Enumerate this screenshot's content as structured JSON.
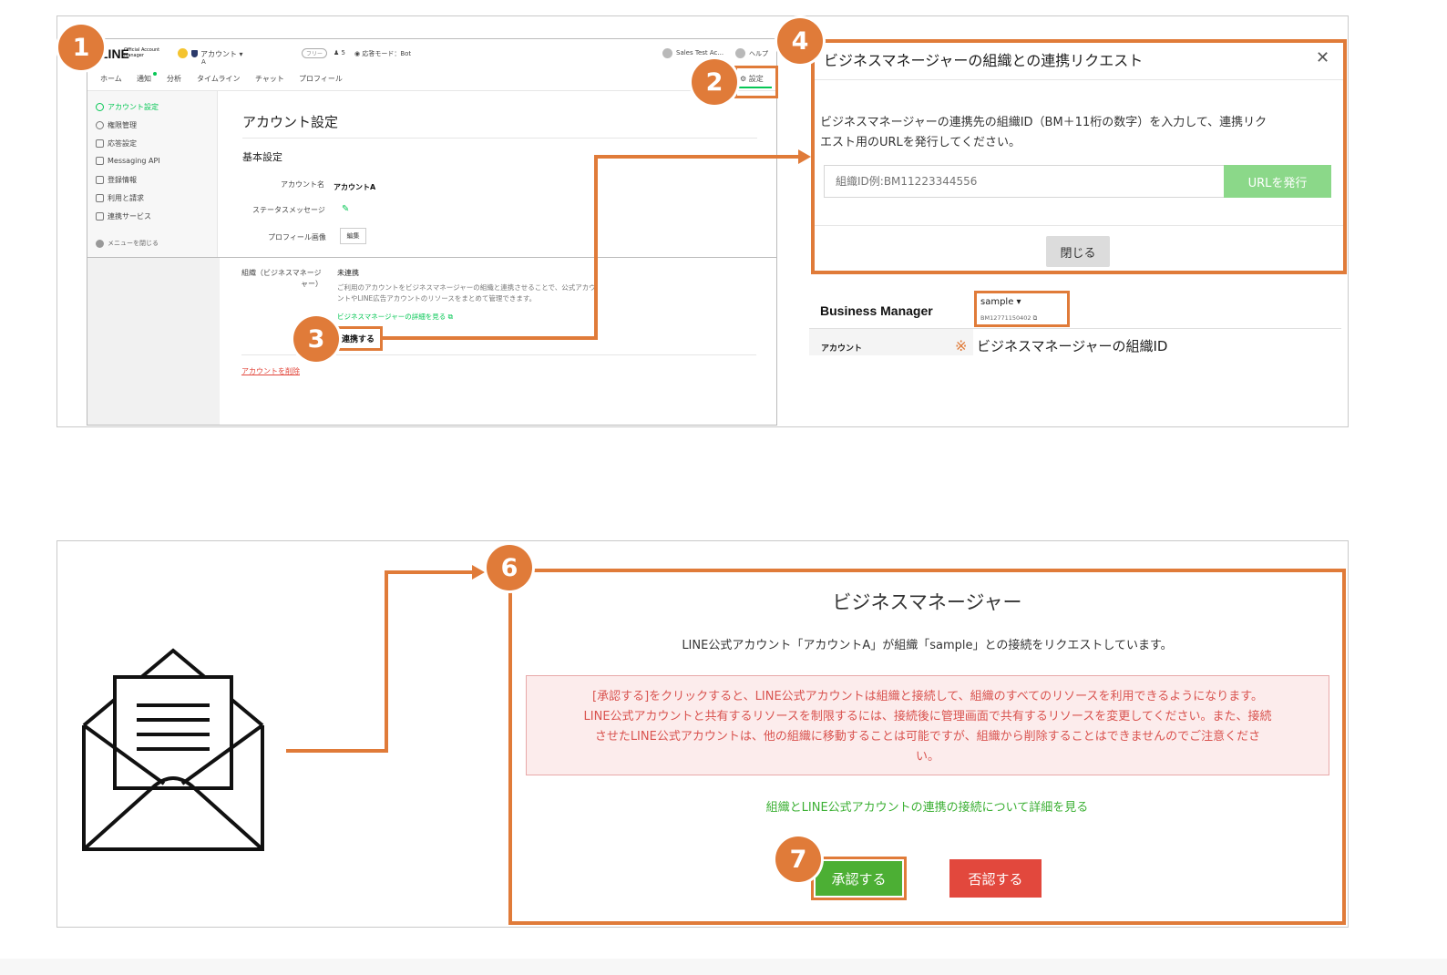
{
  "screen1": {
    "logo": "LINE",
    "logo_sub": "Official Account Manager",
    "account_selector": "アカウント",
    "account_selector_sub": "A",
    "plan_badge": "フリー",
    "followers": "5",
    "response_mode": "応答モード：Bot",
    "user_name": "Sales Test Ac...",
    "help": "ヘルプ",
    "tabs": [
      "ホーム",
      "通知",
      "分析",
      "タイムライン",
      "チャット",
      "プロフィール"
    ],
    "settings_tab": "設定",
    "sidebar": [
      "アカウント設定",
      "権限管理",
      "応答設定",
      "Messaging API",
      "登録情報",
      "利用と請求",
      "連携サービス"
    ],
    "sidebar_close": "メニューを閉じる",
    "page_title": "アカウント設定",
    "section_title": "基本設定",
    "rows": {
      "account_name_label": "アカウント名",
      "account_name_value": "アカウントA",
      "status_label": "ステータスメッセージ",
      "profile_image_label": "プロフィール画像",
      "profile_image_button": "編集",
      "org_label_1": "組織（ビジネスマネージ",
      "org_label_2": "ャー）",
      "org_value": "未連携",
      "org_desc_1": "ご利用のアカウントをビジネスマネージャーの組織と連携させることで、公式アカウ",
      "org_desc_2": "ントやLINE広告アカウントのリソースをまとめて管理できます。",
      "org_link": "ビジネスマネージャーの詳細を見る",
      "connect_button": "連携する"
    },
    "delete_account": "アカウントを削除"
  },
  "dialog": {
    "title": "ビジネスマネージャーの組織との連携リクエスト",
    "description_1": "ビジネスマネージャーの連携先の組織ID（BM＋11桁の数字）を入力して、連携リク",
    "description_2": "エスト用のURLを発行してください。",
    "input_placeholder": "組織ID例:BM11223344556",
    "issue_button": "URLを発行",
    "close_button": "閉じる"
  },
  "bm_header": {
    "title": "Business Manager",
    "org_name": "sample",
    "org_id": "BM12771150402",
    "row_label": "アカウント",
    "note_mark": "※",
    "note": "ビジネスマネージャーの組織ID"
  },
  "approval": {
    "title": "ビジネスマネージャー",
    "request_text": "LINE公式アカウント「アカウントA」が組織「sample」との接続をリクエストしています。",
    "warning_lines": [
      "[承認する]をクリックすると、LINE公式アカウントは組織と接続して、組織のすべてのリソースを利用できるようになります。",
      "LINE公式アカウントと共有するリソースを制限するには、接続後に管理画面で共有するリソースを変更してください。また、接続",
      "させたLINE公式アカウントは、他の組織に移動することは可能ですが、組織から削除することはできませんのでご注意くださ",
      "い。"
    ],
    "details_link": "組織とLINE公式アカウントの連携の接続について詳細を見る",
    "approve_button": "承認する",
    "reject_button": "否認する"
  },
  "steps": [
    "1",
    "2",
    "3",
    "4",
    "6",
    "7"
  ],
  "colors": {
    "accent_orange": "#e07b39",
    "line_green": "#06c755",
    "approve_green": "#4caf34",
    "reject_red": "#e2483d",
    "warning_red": "#d9534f"
  }
}
